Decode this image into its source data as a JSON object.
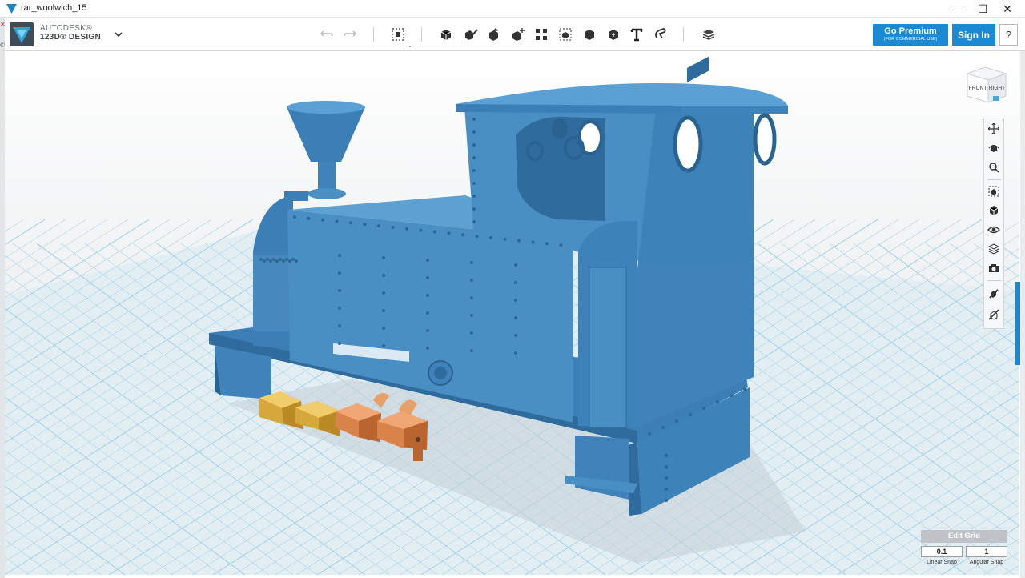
{
  "window": {
    "title": "rar_woolwich_15",
    "controls": {
      "minimize": "—",
      "maximize": "☐",
      "close": "✕"
    }
  },
  "logo": {
    "line1": "AUTODESK®",
    "line2": "123D® DESIGN"
  },
  "toolbar": {
    "tools": [
      "undo-icon",
      "redo-icon",
      "transform-icon",
      "primitives-icon",
      "sketch-icon",
      "construct-icon",
      "modify-icon",
      "pattern-icon",
      "group-icon",
      "combine-icon",
      "measure-icon",
      "text-icon",
      "snap-icon",
      "material-icon"
    ]
  },
  "account": {
    "premium_label": "Go Premium",
    "premium_sub": "(FOR COMMERCIAL USE)",
    "signin_label": "Sign In",
    "help_label": "?"
  },
  "viewcube": {
    "front": "FRONT",
    "right": "RIGHT"
  },
  "navbar": {
    "items": [
      "pan-icon",
      "orbit-icon",
      "zoom-icon",
      "fit-icon",
      "views-icon",
      "visibility-icon",
      "material-view-icon",
      "camera-icon",
      "snap-tool-icon",
      "hide-icon"
    ]
  },
  "grid": {
    "title": "Edit Grid",
    "linear_value": "0.1",
    "angular_value": "1",
    "linear_label": "Linear Snap",
    "angular_label": "Angular Snap"
  },
  "colors": {
    "accent": "#1a8ad4",
    "model_blue": "#4a8fc4",
    "model_yellow": "#d6a73a",
    "model_orange": "#d9824a",
    "grid_bg": "#e3eef3"
  }
}
